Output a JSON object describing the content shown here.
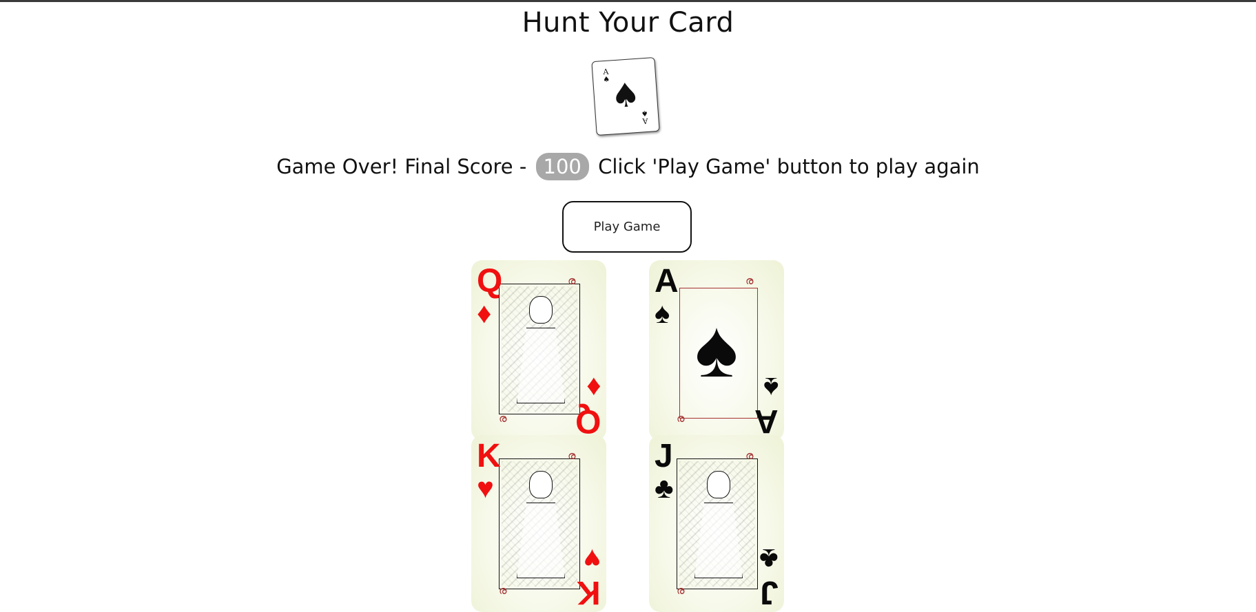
{
  "title": "Hunt Your Card",
  "target_card": {
    "rank": "A",
    "suit": "♠",
    "icon": "spade-icon"
  },
  "status": {
    "prefix": "Game Over! Final Score -",
    "score": "100",
    "suffix": "Click 'Play Game' button to play again"
  },
  "play_button": {
    "label": "Play Game"
  },
  "cards": [
    {
      "rank": "Q",
      "suit": "♦",
      "color": "#f01010",
      "name": "queen-of-diamonds"
    },
    {
      "rank": "A",
      "suit": "♠",
      "color": "#0a0a0a",
      "name": "ace-of-spades"
    },
    {
      "rank": "K",
      "suit": "♥",
      "color": "#f01010",
      "name": "king-of-hearts"
    },
    {
      "rank": "J",
      "suit": "♣",
      "color": "#0a0a0a",
      "name": "jack-of-clubs"
    }
  ],
  "colors": {
    "accent_red": "#f01010",
    "badge_gray": "#a8a8a8",
    "card_face": "#f7f9ea"
  }
}
